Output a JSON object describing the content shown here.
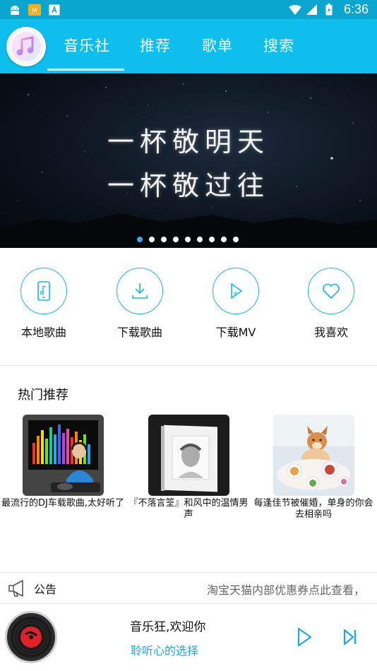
{
  "status_bar": {
    "time": "6:36",
    "icons": [
      "android-icon",
      "app-notification-icon",
      "store-icon",
      "wifi-icon",
      "signal-icon",
      "battery-icon"
    ]
  },
  "header": {
    "tabs": [
      {
        "label": "音乐社",
        "active": true
      },
      {
        "label": "推荐",
        "active": false
      },
      {
        "label": "歌单",
        "active": false
      },
      {
        "label": "搜索",
        "active": false
      }
    ]
  },
  "banner": {
    "line1": "一杯敬明天",
    "line2": "一杯敬过往",
    "page_count": 9,
    "active_index": 0
  },
  "actions": [
    {
      "label": "本地歌曲",
      "icon": "phone-music-icon"
    },
    {
      "label": "下载歌曲",
      "icon": "download-icon"
    },
    {
      "label": "下载MV",
      "icon": "video-play-icon"
    },
    {
      "label": "我喜欢",
      "icon": "heart-icon"
    }
  ],
  "hot": {
    "title": "热门推荐",
    "items": [
      {
        "title": "最流行的DJ车载歌曲,太好听了"
      },
      {
        "title": "『不落言筌』和风中的温情男声"
      },
      {
        "title": "每逢佳节被催婚，单身的你会去相亲吗"
      }
    ]
  },
  "notice": {
    "label": "公告",
    "text": "淘宝天猫内部优惠券点此查看，"
  },
  "player": {
    "title": "音乐狂,欢迎你",
    "subtitle": "聆听心的选择"
  },
  "colors": {
    "accent": "#0ebfed",
    "icon_stroke": "#18b4e6",
    "dot_active": "#39a7f0",
    "subtitle": "#22a7de"
  }
}
